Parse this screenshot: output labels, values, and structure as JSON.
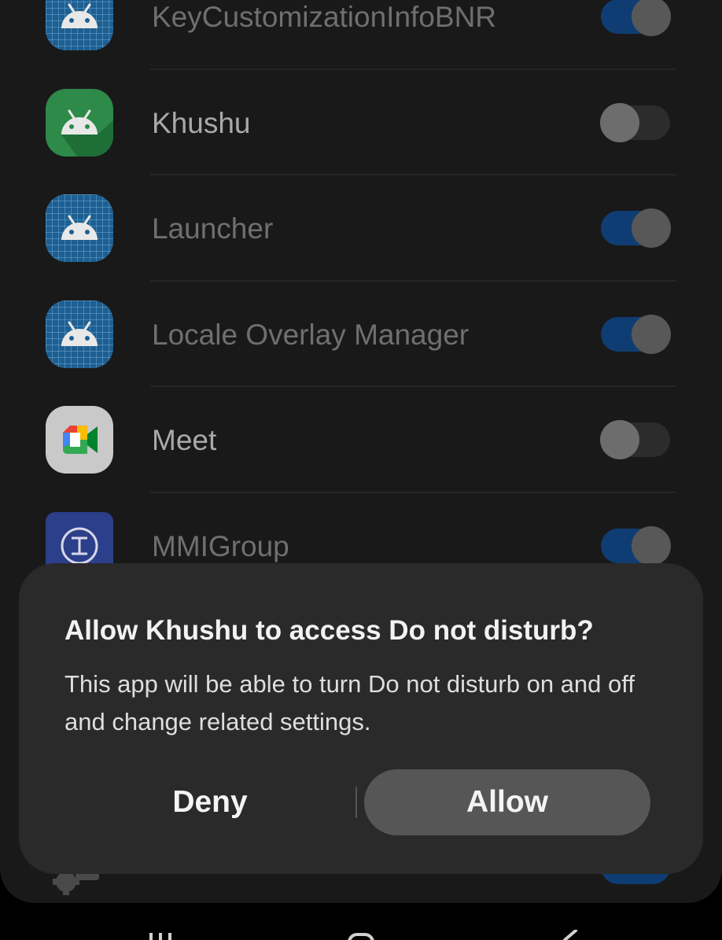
{
  "app_list": [
    {
      "name": "KeyCustomizationInfoBNR",
      "icon": "android-grid-icon",
      "toggle": "on",
      "enabled": false
    },
    {
      "name": "Khushu",
      "icon": "android-green-icon",
      "toggle": "off",
      "enabled": true
    },
    {
      "name": "Launcher",
      "icon": "android-grid-icon",
      "toggle": "on",
      "enabled": false
    },
    {
      "name": "Locale Overlay Manager",
      "icon": "android-grid-icon",
      "toggle": "on",
      "enabled": false
    },
    {
      "name": "Meet",
      "icon": "google-meet-icon",
      "toggle": "off",
      "enabled": true
    },
    {
      "name": "MMIGroup",
      "icon": "mmi-group-icon",
      "toggle": "on",
      "enabled": false
    }
  ],
  "bottom_row": {
    "icon": "gear-icon",
    "toggle": "on"
  },
  "dialog": {
    "title": "Allow Khushu to access Do not disturb?",
    "body": "This app will be able to turn Do not disturb on and off and change related settings.",
    "deny_label": "Deny",
    "allow_label": "Allow"
  },
  "navbar": {
    "recents_icon": "recents-icon",
    "home_icon": "home-icon",
    "back_icon": "back-icon"
  },
  "colors": {
    "toggle_on_track": "#0f3d73",
    "dialog_background": "#2a2a2a",
    "allow_button": "#565656"
  }
}
